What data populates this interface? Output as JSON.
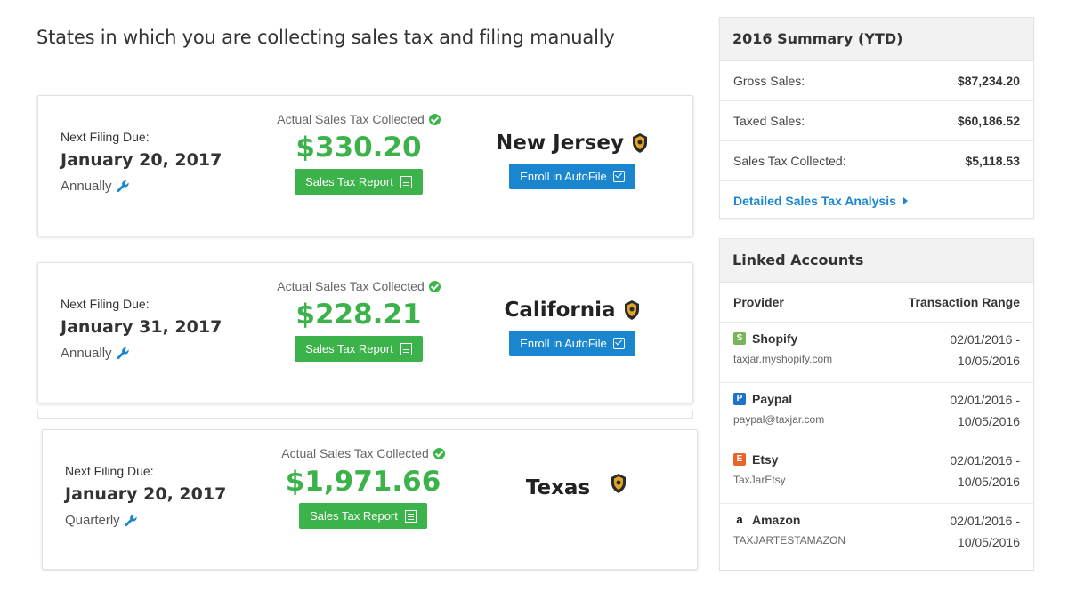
{
  "page_title": "States in which you are collecting sales tax and filing manually",
  "states": [
    {
      "due_label": "Next Filing Due:",
      "due_date": "January 20, 2017",
      "frequency": "Annually",
      "collected_label": "Actual Sales Tax Collected",
      "amount": "$330.20",
      "report_button": "Sales Tax Report",
      "state": "New Jersey",
      "autofile_button": "Enroll in AutoFile"
    },
    {
      "due_label": "Next Filing Due:",
      "due_date": "January 31, 2017",
      "frequency": "Annually",
      "collected_label": "Actual Sales Tax Collected",
      "amount": "$228.21",
      "report_button": "Sales Tax Report",
      "state": "California",
      "autofile_button": "Enroll in AutoFile"
    },
    {
      "due_label": "Next Filing Due:",
      "due_date": "January 20, 2017",
      "frequency": "Quarterly",
      "collected_label": "Actual Sales Tax Collected",
      "amount": "$1,971.66",
      "report_button": "Sales Tax Report",
      "state": "Texas"
    }
  ],
  "summary": {
    "title": "2016 Summary (YTD)",
    "rows": [
      {
        "label": "Gross Sales:",
        "value": "$87,234.20"
      },
      {
        "label": "Taxed Sales:",
        "value": "$60,186.52"
      },
      {
        "label": "Sales Tax Collected:",
        "value": "$5,118.53"
      }
    ],
    "link": "Detailed Sales Tax Analysis"
  },
  "linked": {
    "title": "Linked Accounts",
    "col_provider": "Provider",
    "col_range": "Transaction Range",
    "accounts": [
      {
        "provider": "Shopify",
        "account": "taxjar.myshopify.com",
        "start": "02/01/2016 -",
        "end": "10/05/2016",
        "icon": "shopify-icon"
      },
      {
        "provider": "Paypal",
        "account": "paypal@taxjar.com",
        "start": "02/01/2016 -",
        "end": "10/05/2016",
        "icon": "paypal-icon"
      },
      {
        "provider": "Etsy",
        "account": "TaxJarEtsy",
        "start": "02/01/2016 -",
        "end": "10/05/2016",
        "icon": "etsy-icon"
      },
      {
        "provider": "Amazon",
        "account": "TAXJARTESTAMAZON",
        "start": "02/01/2016 -",
        "end": "10/05/2016",
        "icon": "amazon-icon"
      }
    ]
  },
  "colors": {
    "green": "#3cb34a",
    "blue": "#1a86d0"
  }
}
